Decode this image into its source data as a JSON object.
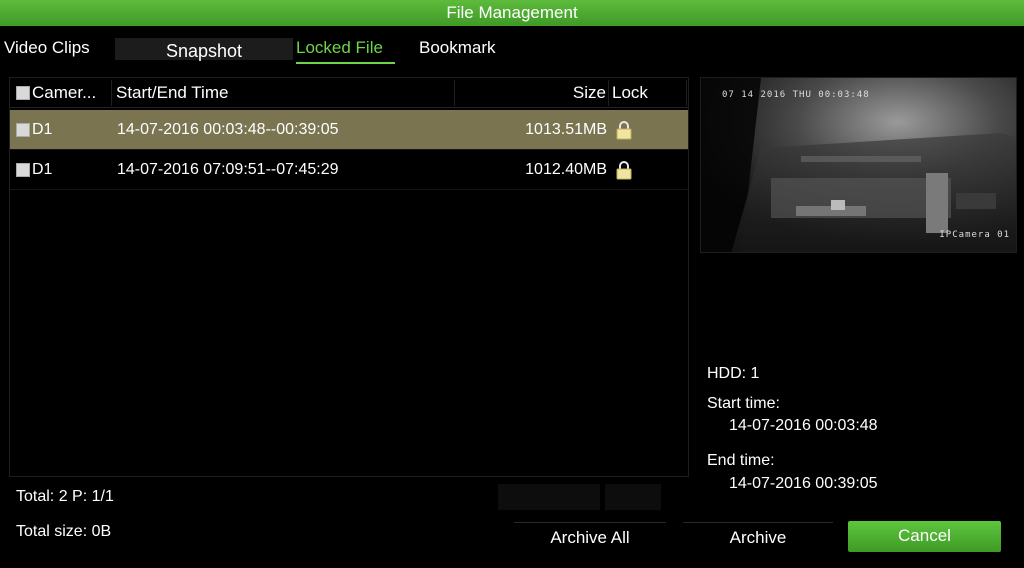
{
  "window": {
    "title": "File Management"
  },
  "tabs": [
    {
      "label": "Video Clips"
    },
    {
      "label": "Snapshot"
    },
    {
      "label": "Locked File"
    },
    {
      "label": "Bookmark"
    }
  ],
  "table": {
    "columns": {
      "camera": "Camer...",
      "time": "Start/End Time",
      "size": "Size",
      "lock": "Lock"
    },
    "rows": [
      {
        "camera": "D1",
        "time": "14-07-2016 00:03:48--00:39:05",
        "size": "1013.51MB",
        "lock_icon": "padlock-icon",
        "selected": true
      },
      {
        "camera": "D1",
        "time": "14-07-2016 07:09:51--07:45:29",
        "size": "1012.40MB",
        "lock_icon": "padlock-icon",
        "selected": false
      }
    ]
  },
  "preview": {
    "osd_time": "07 14 2016 THU 00:03:48",
    "osd_camera": "IPCamera 01"
  },
  "details": {
    "hdd": "HDD: 1",
    "start_label": "Start time:",
    "start_value": "14-07-2016 00:03:48",
    "end_label": "End time:",
    "end_value": "14-07-2016 00:39:05"
  },
  "footer": {
    "total": "Total: 2  P: 1/1",
    "total_size": "Total size: 0B"
  },
  "buttons": {
    "archive_all": "Archive All",
    "archive": "Archive",
    "cancel": "Cancel"
  },
  "colors": {
    "accent_green": "#4caf35",
    "active_tab": "#6fd44a",
    "selected_row": "#7a7450"
  }
}
